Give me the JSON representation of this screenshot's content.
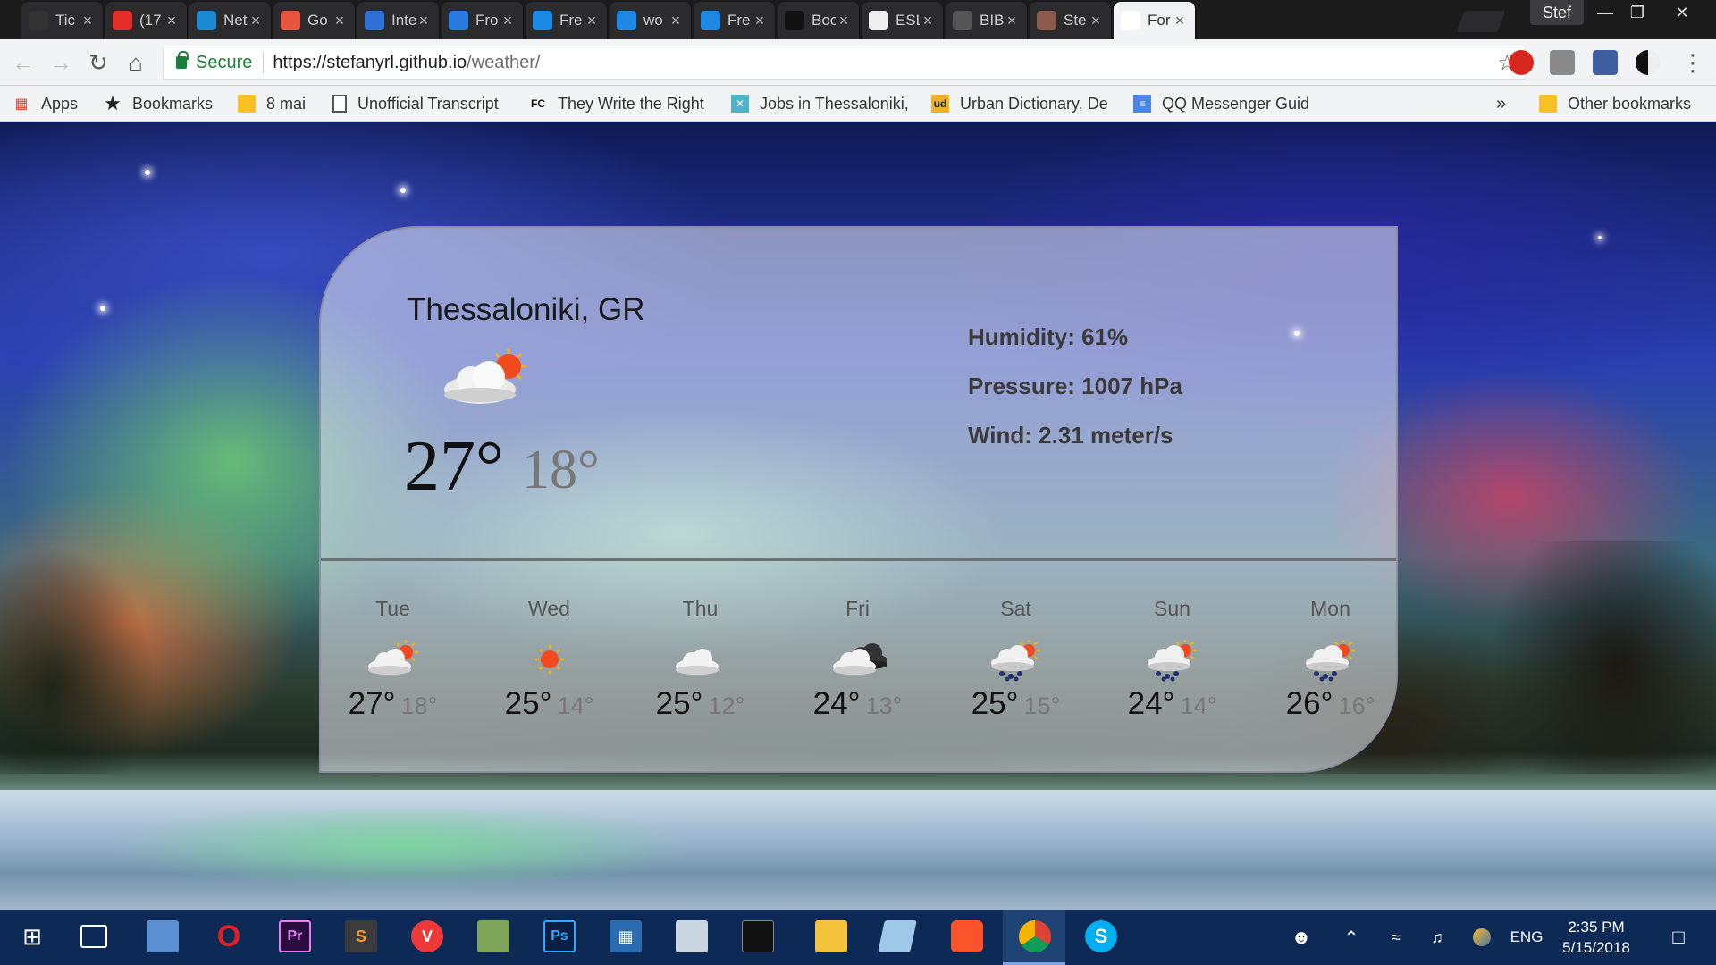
{
  "tabs": [
    {
      "title": "Tic",
      "icon": "github-icon",
      "color": "#333333"
    },
    {
      "title": "(17",
      "icon": "youtube-icon",
      "color": "#e52d27"
    },
    {
      "title": "Net",
      "icon": "circle-icon",
      "color": "#1a8ad4"
    },
    {
      "title": "Go",
      "icon": "target-icon",
      "color": "#e8553e"
    },
    {
      "title": "Inte",
      "icon": "diamond-icon",
      "color": "#2f6fd6"
    },
    {
      "title": "Fro",
      "icon": "info-icon",
      "color": "#2a7be0"
    },
    {
      "title": "Fre",
      "icon": "y-icon",
      "color": "#1d89e4"
    },
    {
      "title": "wo",
      "icon": "y-icon",
      "color": "#1d89e4"
    },
    {
      "title": "Fre",
      "icon": "y-icon",
      "color": "#1d89e4"
    },
    {
      "title": "Boo",
      "icon": "d-icon",
      "color": "#111111"
    },
    {
      "title": "ESL",
      "icon": "chat-icon",
      "color": "#eeeeee"
    },
    {
      "title": "BIB",
      "icon": "mortarboard-icon",
      "color": "#555555"
    },
    {
      "title": "Ste",
      "icon": "avatar-icon",
      "color": "#8a5a4a"
    },
    {
      "title": "For",
      "icon": "page-icon",
      "color": "#ffffff",
      "active": true
    }
  ],
  "profile_name": "Stef",
  "address": {
    "secure_label": "Secure",
    "url_host": "https://stefanyrl.github.io",
    "url_path": "/weather/"
  },
  "bookmarks": {
    "apps": "Apps",
    "bookmarks": "Bookmarks",
    "items": [
      "8 mai",
      "Unofficial Transcript",
      "They Write the Right",
      "Jobs in Thessaloniki,",
      "Urban Dictionary, De",
      "QQ Messenger Guid"
    ],
    "fc_label": "FC",
    "ud_label": "ud",
    "overflow": "»",
    "other": "Other bookmarks"
  },
  "weather": {
    "city": "Thessaloniki, GR",
    "current_icon": "partly-cloudy-icon",
    "temp_high": "27°",
    "temp_low": "18°",
    "humidity": "Humidity: 61%",
    "pressure": "Pressure: 1007 hPa",
    "wind": "Wind: 2.31 meter/s",
    "forecast": [
      {
        "day": "Tue",
        "icon": "partly-cloudy-icon",
        "high": "27°",
        "low": "18°"
      },
      {
        "day": "Wed",
        "icon": "sun-icon",
        "high": "25°",
        "low": "14°"
      },
      {
        "day": "Thu",
        "icon": "cloud-icon",
        "high": "25°",
        "low": "12°"
      },
      {
        "day": "Fri",
        "icon": "dark-cloud-icon",
        "high": "24°",
        "low": "13°"
      },
      {
        "day": "Sat",
        "icon": "rain-sun-icon",
        "high": "25°",
        "low": "15°"
      },
      {
        "day": "Sun",
        "icon": "rain-sun-icon",
        "high": "24°",
        "low": "14°"
      },
      {
        "day": "Mon",
        "icon": "rain-sun-icon",
        "high": "26°",
        "low": "16°"
      }
    ]
  },
  "taskbar": {
    "language": "ENG",
    "time": "2:35 PM",
    "date": "5/15/2018"
  }
}
